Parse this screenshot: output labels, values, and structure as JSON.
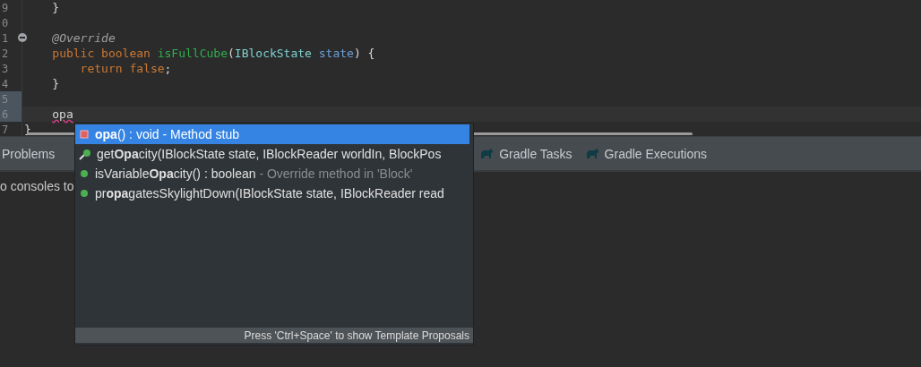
{
  "editor": {
    "lines": [
      {
        "number": "9",
        "fold": false,
        "current": false,
        "marked": false,
        "tokens": [
          {
            "kind": "plain",
            "text": "    }"
          }
        ]
      },
      {
        "number": "0",
        "fold": false,
        "current": false,
        "marked": false
      },
      {
        "number": "1",
        "fold": true,
        "current": false,
        "marked": false,
        "tokens": [
          {
            "kind": "annotation",
            "text": "    @Override"
          }
        ]
      },
      {
        "number": "2",
        "fold": false,
        "current": false,
        "marked": false,
        "tokens": [
          {
            "kind": "keyword",
            "text": "    public boolean "
          },
          {
            "kind": "method",
            "text": "isFullCube"
          },
          {
            "kind": "plain",
            "text": "("
          },
          {
            "kind": "type",
            "text": "IBlockState"
          },
          {
            "kind": "param",
            "text": " state"
          },
          {
            "kind": "plain",
            "text": ") {"
          }
        ]
      },
      {
        "number": "3",
        "fold": false,
        "current": false,
        "marked": false,
        "tokens": [
          {
            "kind": "keyword",
            "text": "        return false"
          },
          {
            "kind": "plain",
            "text": ";"
          }
        ]
      },
      {
        "number": "4",
        "fold": false,
        "current": false,
        "marked": false,
        "tokens": [
          {
            "kind": "plain",
            "text": "    }"
          }
        ]
      },
      {
        "number": "5",
        "fold": false,
        "current": false,
        "marked": true
      },
      {
        "number": "6",
        "fold": false,
        "current": true,
        "marked": true,
        "tokens": [
          {
            "kind": "error",
            "text": "opa"
          }
        ]
      },
      {
        "number": "7",
        "fold": false,
        "current": false,
        "marked": false,
        "tokens": [
          {
            "kind": "plain",
            "text": "}"
          }
        ]
      }
    ]
  },
  "views": {
    "tabs": [
      {
        "label": "Problems"
      },
      {
        "label": "Gradle Tasks"
      },
      {
        "label": "Gradle Executions"
      }
    ],
    "console_text": "o consoles to"
  },
  "completion": {
    "items": [
      {
        "kind": "stub",
        "text": "**opa**() : void - Method stub",
        "selected": true
      },
      {
        "kind": "override",
        "text": "get**Opa**city(IBlockState state, IBlockReader worldIn, BlockPos",
        "selected": false
      },
      {
        "kind": "method",
        "text": "isVariable**Opa**city() : boolean",
        "detail": "- Override method in 'Block'",
        "selected": false
      },
      {
        "kind": "method",
        "text": "pr**opa**gatesSkylightDown(IBlockState state, IBlockReader read",
        "selected": false
      }
    ],
    "hint": "Press 'Ctrl+Space' to show Template Proposals"
  }
}
